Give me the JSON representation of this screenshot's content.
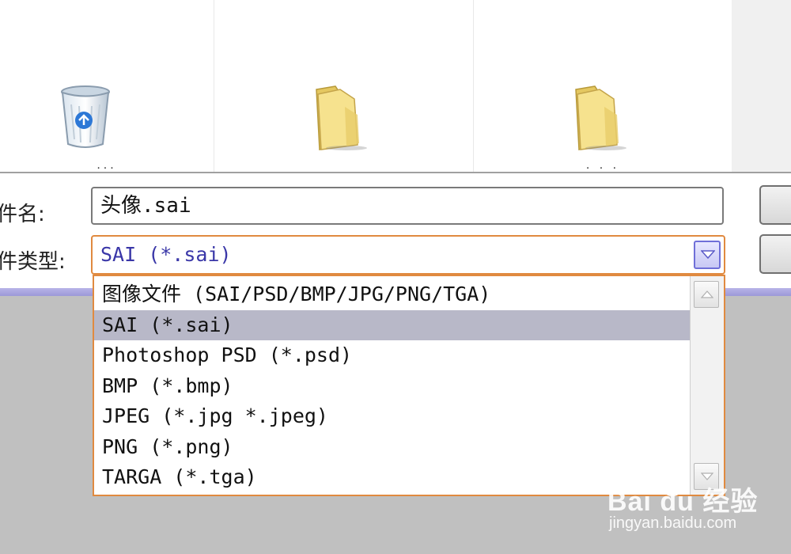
{
  "browser": {
    "items": [
      {
        "icon": "recycle-bin-icon",
        "label": "..."
      },
      {
        "icon": "folder-icon",
        "label": ""
      },
      {
        "icon": "folder-icon",
        "label": ". . ."
      }
    ]
  },
  "dialog": {
    "filename_label": "件名:",
    "filename_value": "头像.sai",
    "filetype_label": "件类型:",
    "filetype_selected": "SAI (*.sai)"
  },
  "dropdown": {
    "options": [
      "图像文件 (SAI/PSD/BMP/JPG/PNG/TGA)",
      "SAI (*.sai)",
      "Photoshop PSD (*.psd)",
      "BMP (*.bmp)",
      "JPEG (*.jpg *.jpeg)",
      "PNG (*.png)",
      "TARGA (*.tga)"
    ],
    "selected_index": 1
  },
  "watermark": {
    "logo": "Bai du 经验",
    "url": "jingyan.baidu.com"
  },
  "colors": {
    "focus_border": "#e08a40",
    "selected_text": "#3a37a8",
    "selected_row": "#b8b8c8"
  }
}
